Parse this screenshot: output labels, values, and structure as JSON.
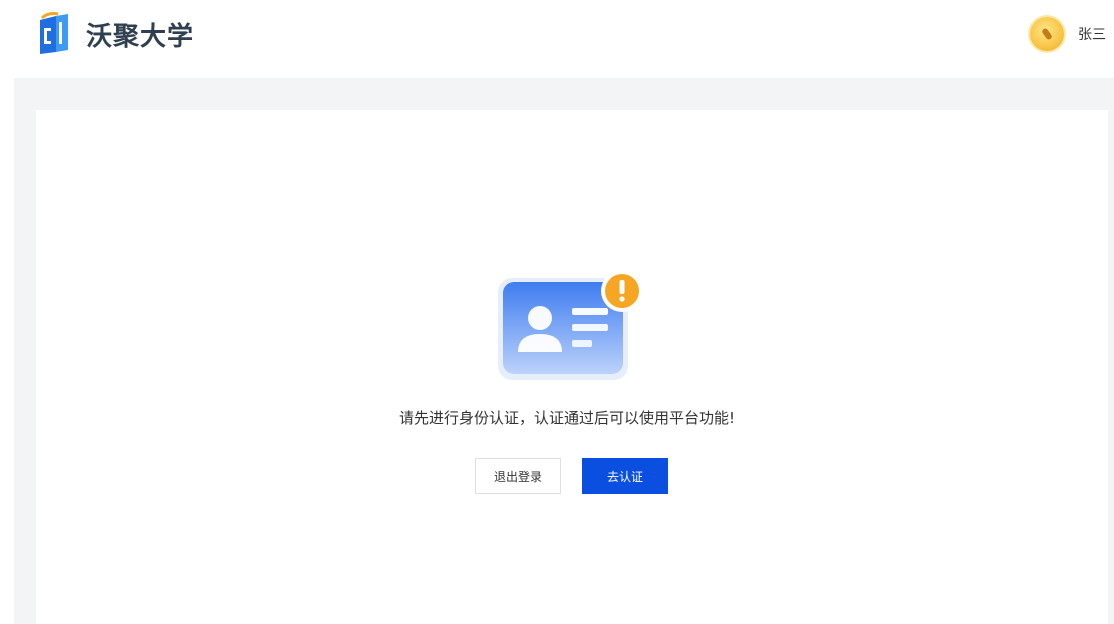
{
  "header": {
    "brand_name": "沃聚大学",
    "user_name": "张三"
  },
  "main": {
    "message": "请先进行身份认证，认证通过后可以使用平台功能!",
    "logout_label": "退出登录",
    "verify_label": "去认证"
  },
  "icons": {
    "logo": "brand-logo-icon",
    "avatar": "user-avatar",
    "illustration": "id-card-warning-icon"
  },
  "colors": {
    "primary": "#0a4fdf",
    "warning": "#f6a623",
    "page_bg": "#f3f4f6"
  }
}
